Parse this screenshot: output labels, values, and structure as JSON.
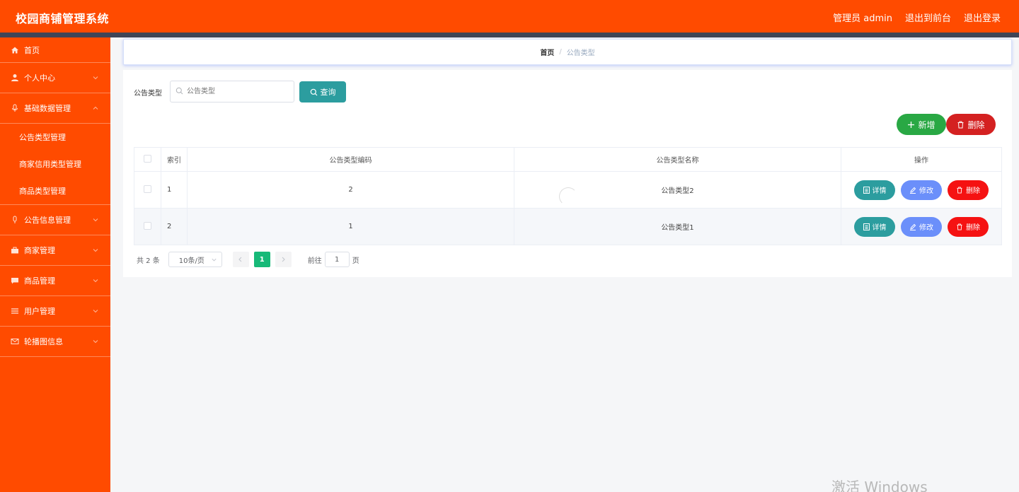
{
  "header": {
    "title": "校园商铺管理系统",
    "admin_label": "管理员 admin",
    "front_label": "退出到前台",
    "logout_label": "退出登录"
  },
  "sidebar": {
    "home": "首页",
    "personal": "个人中心",
    "basic": "基础数据管理",
    "basic_sub": [
      "公告类型管理",
      "商家信用类型管理",
      "商品类型管理"
    ],
    "notice": "公告信息管理",
    "merchant": "商家管理",
    "product": "商品管理",
    "user": "用户管理",
    "banner": "轮播图信息"
  },
  "breadcrumb": {
    "home": "首页",
    "separator": "/",
    "current": "公告类型"
  },
  "filter": {
    "label": "公告类型",
    "placeholder": "公告类型",
    "query_button": "查询"
  },
  "actions": {
    "add_label": "新增",
    "delete_label": "删除"
  },
  "table": {
    "headers": [
      "索引",
      "公告类型编码",
      "公告类型名称",
      "操作"
    ],
    "rows": [
      {
        "index": "1",
        "code": "2",
        "name": "公告类型2"
      },
      {
        "index": "2",
        "code": "1",
        "name": "公告类型1"
      }
    ],
    "op_labels": {
      "detail": "详情",
      "edit": "修改",
      "delete": "删除"
    }
  },
  "pagination": {
    "total_text": "共 2 条",
    "page_size": "10条/页",
    "current_page": "1",
    "goto_label": "前往",
    "goto_value": "1",
    "page_suffix": "页"
  },
  "watermark": "激活 Windows",
  "colors": {
    "brand": "#ff4b00",
    "query": "#2c9d9f",
    "add": "#29a844",
    "delete": "#d42121",
    "edit": "#6b8ffa",
    "row_delete": "#f51212",
    "active_page": "#17b978"
  }
}
